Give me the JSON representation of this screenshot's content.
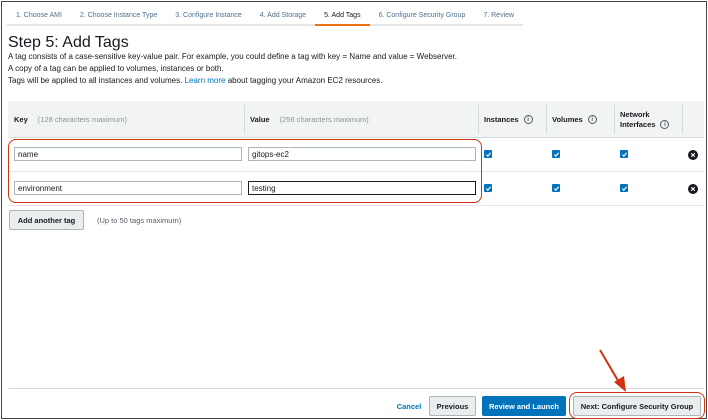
{
  "wizard": {
    "tabs": [
      {
        "label": "1. Choose AMI",
        "active": false
      },
      {
        "label": "2. Choose Instance Type",
        "active": false
      },
      {
        "label": "3. Configure Instance",
        "active": false
      },
      {
        "label": "4. Add Storage",
        "active": false
      },
      {
        "label": "5. Add Tags",
        "active": true
      },
      {
        "label": "6. Configure Security Group",
        "active": false
      },
      {
        "label": "7. Review",
        "active": false
      }
    ]
  },
  "page": {
    "title": "Step 5: Add Tags",
    "desc_line1": "A tag consists of a case-sensitive key-value pair. For example, you could define a tag with key = Name and value = Webserver.",
    "desc_line2": "A copy of a tag can be applied to volumes, instances or both.",
    "desc_line3_prefix": "Tags will be applied to all instances and volumes.",
    "desc_line3_link": "Learn more",
    "desc_line3_suffix": "about tagging your Amazon EC2 resources."
  },
  "table": {
    "headers": {
      "key": "Key",
      "key_hint": "(128 characters maximum)",
      "value": "Value",
      "value_hint": "(256 characters maximum)",
      "instances": "Instances",
      "volumes": "Volumes",
      "network_line1": "Network",
      "network_line2": "Interfaces"
    },
    "rows": [
      {
        "key": "name",
        "value": "gitops-ec2",
        "instances": true,
        "volumes": true,
        "network": true
      },
      {
        "key": "environment",
        "value": "testing",
        "instances": true,
        "volumes": true,
        "network": true
      }
    ]
  },
  "actions": {
    "add_tag": "Add another tag",
    "add_tag_hint": "(Up to 50 tags maximum)",
    "cancel": "Cancel",
    "previous": "Previous",
    "review_launch": "Review and Launch",
    "next": "Next: Configure Security Group"
  },
  "colors": {
    "accent_orange": "#ec7211",
    "primary_blue": "#0073bb",
    "annotation_red": "#d13212"
  }
}
